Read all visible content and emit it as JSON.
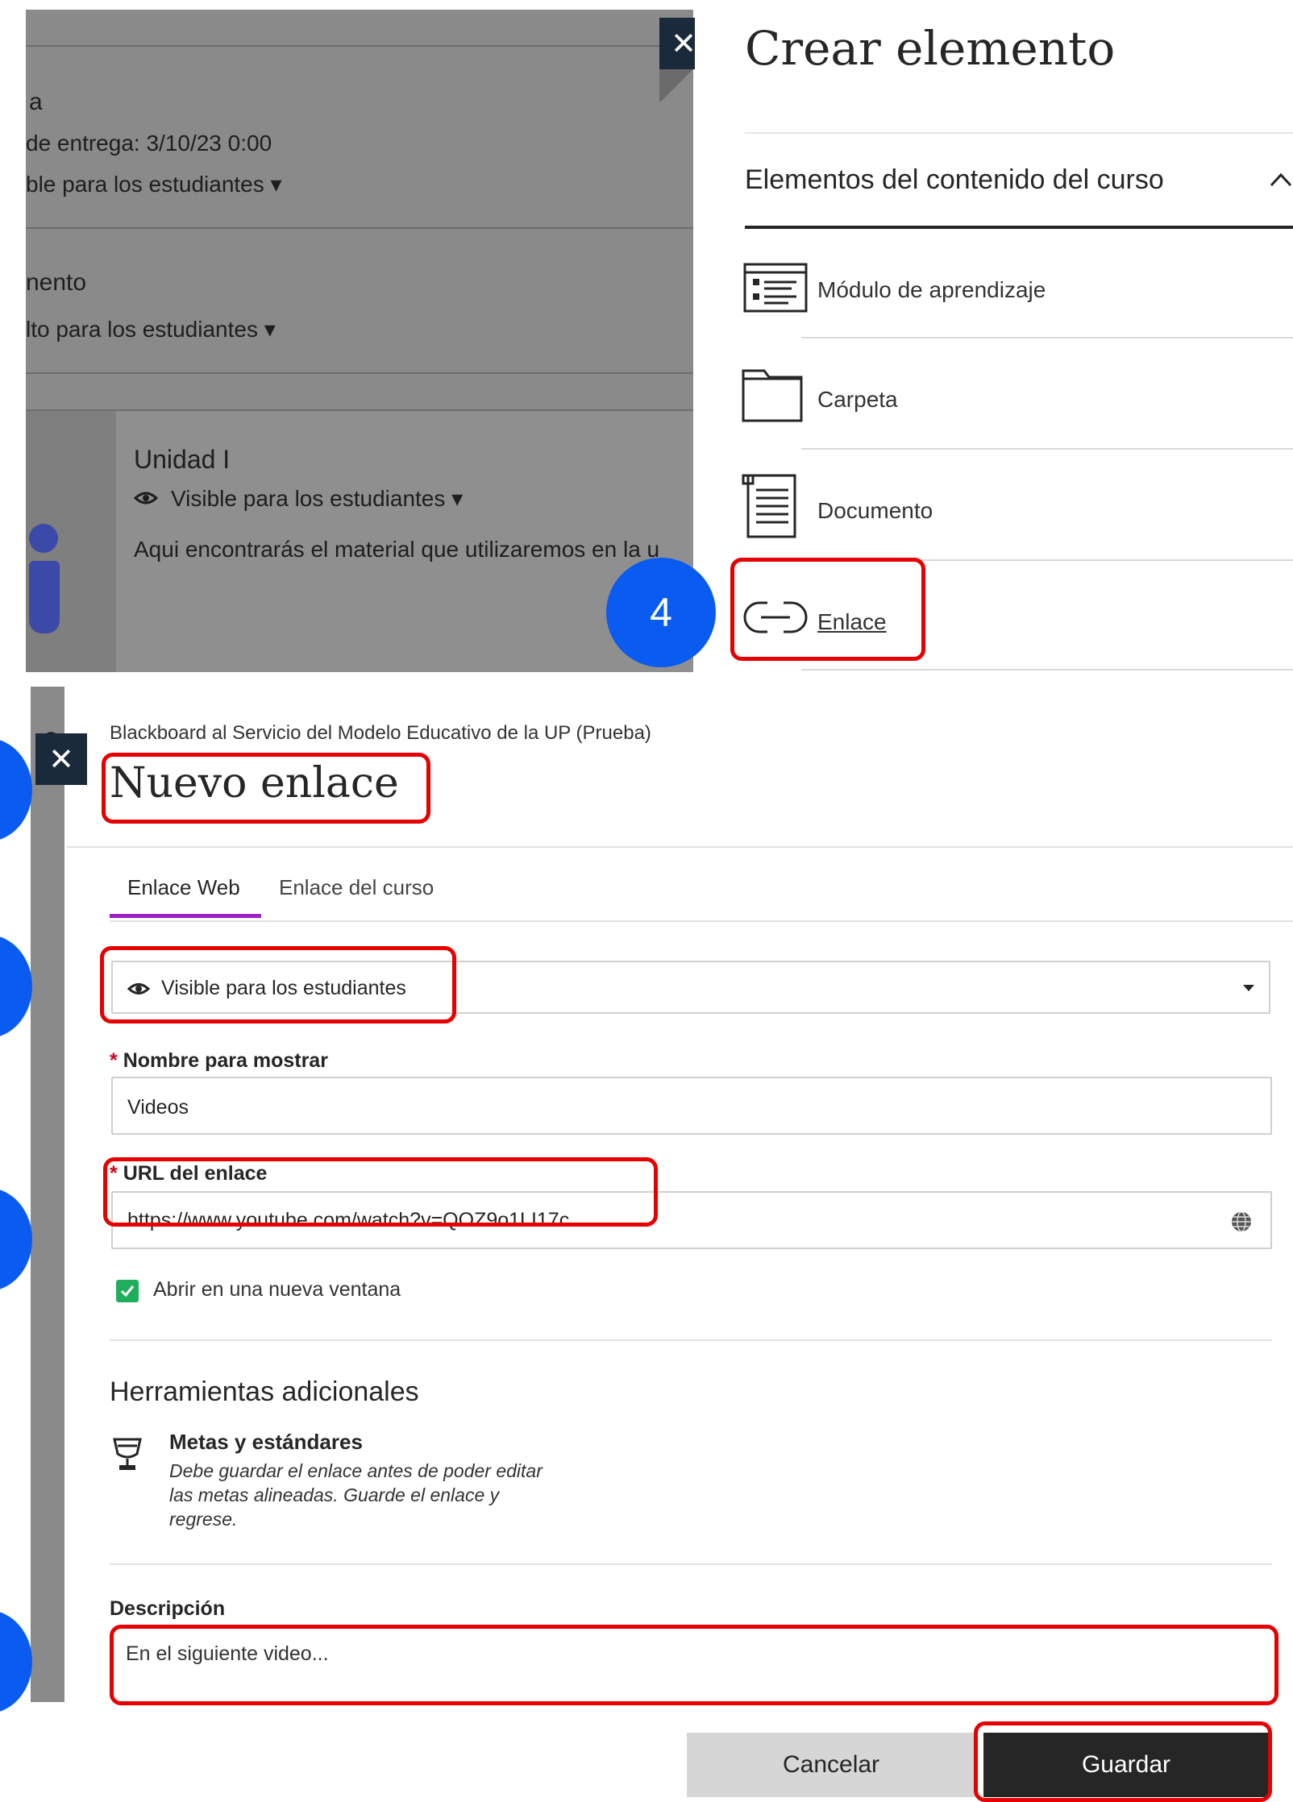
{
  "background_course": {
    "assignment_title_fragment": "a",
    "due_date": "de entrega: 3/10/23 0:00",
    "visibility_1": "ble para los estudiantes ▾",
    "item_fragment": "nento",
    "visibility_2": "lto para los estudiantes ▾",
    "unit_title": "Unidad I",
    "unit_visibility": "Visible para los estudiantes ▾",
    "unit_description": "Aqui encontrarás el material que utilizaremos en la u"
  },
  "crear_panel": {
    "title": "Crear elemento",
    "section_title": "Elementos del contenido del curso",
    "items": [
      {
        "label": "Módulo de aprendizaje",
        "icon": "learning-module-icon"
      },
      {
        "label": "Carpeta",
        "icon": "folder-icon"
      },
      {
        "label": "Documento",
        "icon": "document-icon"
      },
      {
        "label": "Enlace",
        "icon": "link-icon"
      }
    ],
    "step_badge": "4"
  },
  "nuevo_enlace": {
    "course_name": "Blackboard al Servicio del Modelo Educativo de la UP (Prueba)",
    "title": "Nuevo enlace",
    "tabs": [
      {
        "label": "Enlace Web",
        "active": true
      },
      {
        "label": "Enlace del curso",
        "active": false
      }
    ],
    "visibility_value": "Visible para los estudiantes",
    "display_name_label": "Nombre para mostrar",
    "display_name_value": "Videos",
    "url_label": "URL del enlace",
    "url_value": "https://www.youtube.com/watch?v=QOZ9o1LI17c",
    "required_mark": "*",
    "open_new_window_label": "Abrir en una nueva ventana",
    "open_new_window_checked": true,
    "additional_tools_title": "Herramientas adicionales",
    "goals_title": "Metas y estándares",
    "goals_note": "Debe guardar el enlace antes de poder editar las metas alineadas. Guarde el enlace y regrese.",
    "description_label": "Descripción",
    "description_value": "En el siguiente video...",
    "cancel_label": "Cancelar",
    "save_label": "Guardar"
  },
  "colors": {
    "annotation_red": "#e60000",
    "step_blue": "#0a5bf0",
    "close_button": "#1b2a3a",
    "tab_active_underline": "#a020c8",
    "checkbox_green": "#1fae5b"
  }
}
